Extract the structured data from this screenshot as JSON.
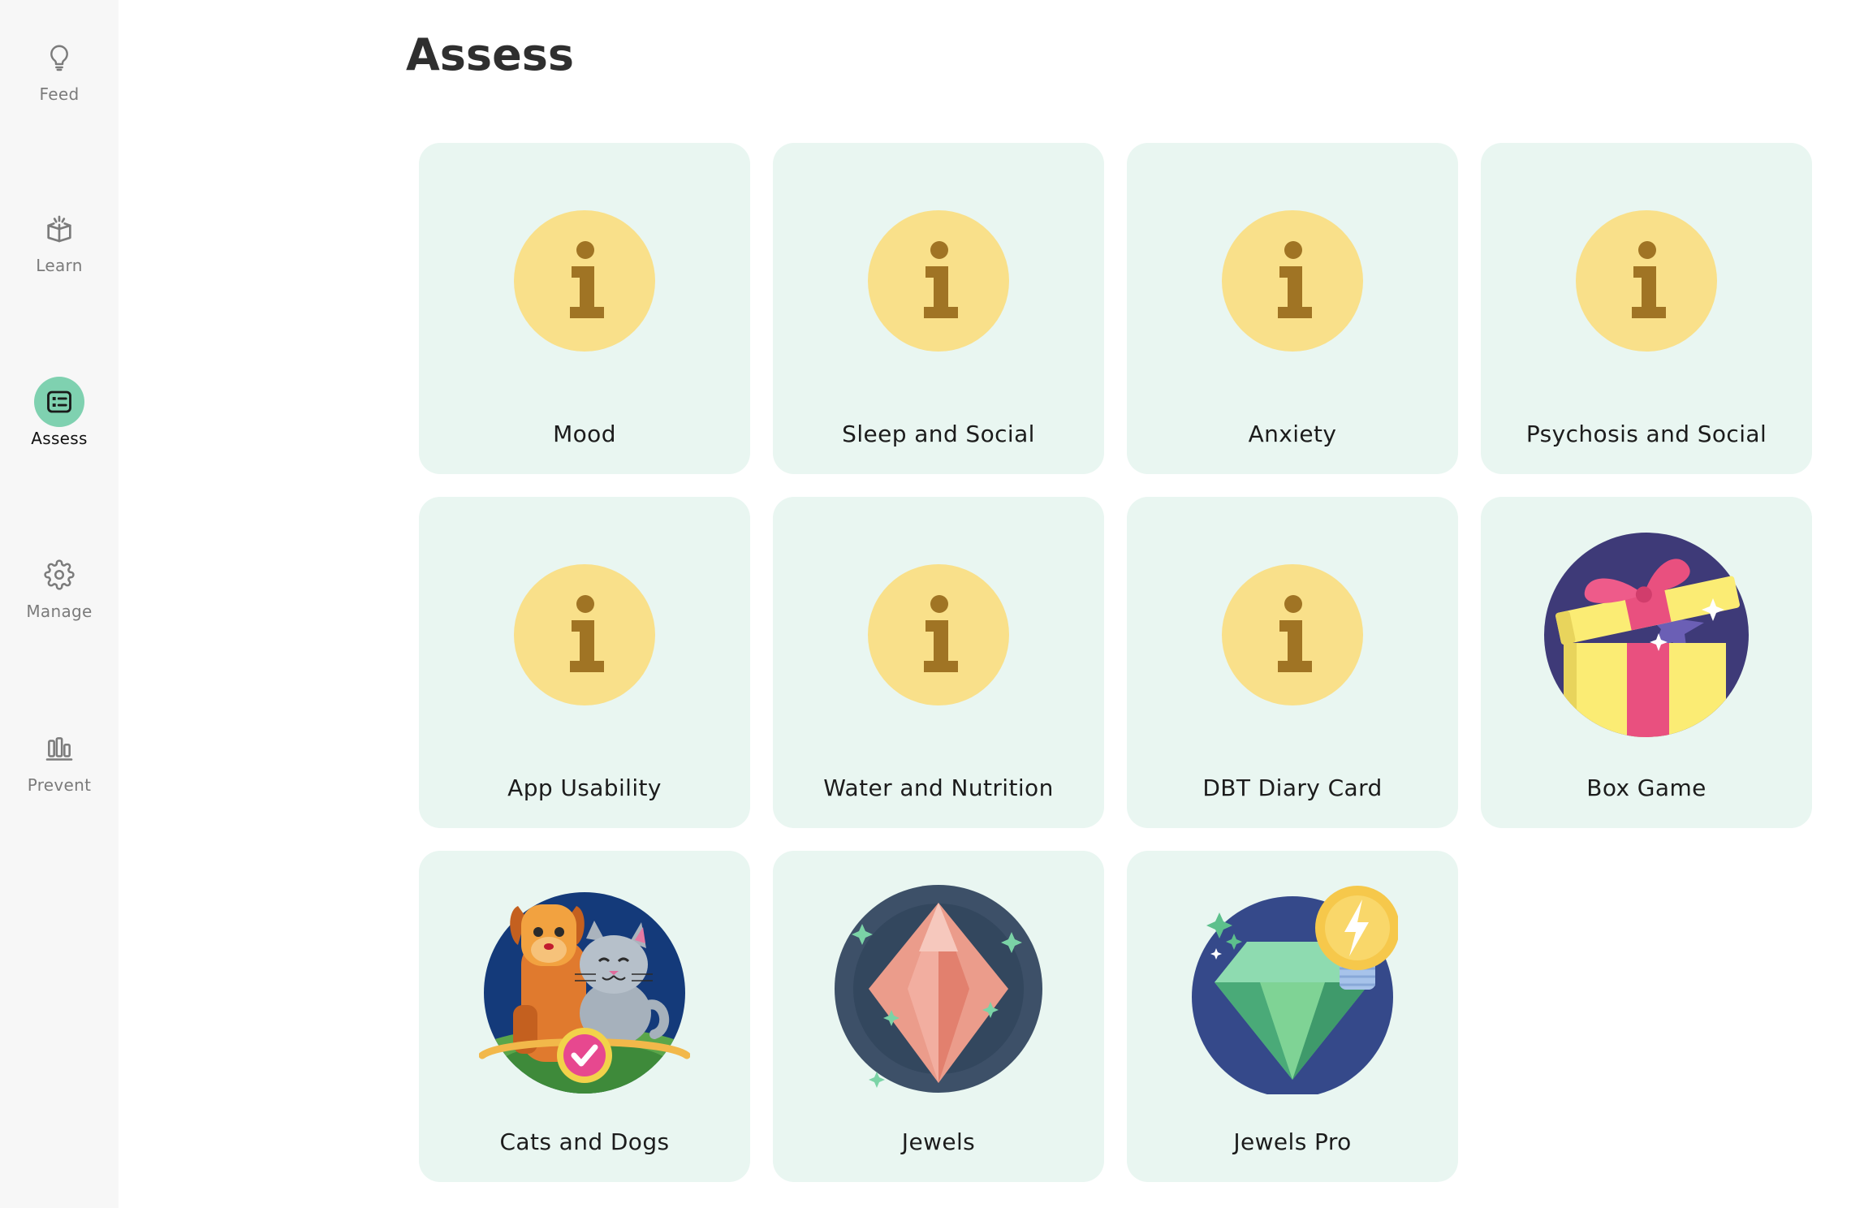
{
  "sidebar": {
    "items": [
      {
        "label": "Feed",
        "icon": "lightbulb-icon",
        "active": false
      },
      {
        "label": "Learn",
        "icon": "open-book-icon",
        "active": false
      },
      {
        "label": "Assess",
        "icon": "assessment-list-icon",
        "active": true
      },
      {
        "label": "Manage",
        "icon": "gear-icon",
        "active": false
      },
      {
        "label": "Prevent",
        "icon": "bar-chart-icon",
        "active": false
      }
    ]
  },
  "page": {
    "title": "Assess"
  },
  "activities": [
    {
      "label": "Mood",
      "icon": "info-icon"
    },
    {
      "label": "Sleep and Social",
      "icon": "info-icon"
    },
    {
      "label": "Anxiety",
      "icon": "info-icon"
    },
    {
      "label": "Psychosis and Social",
      "icon": "info-icon"
    },
    {
      "label": "App Usability",
      "icon": "info-icon"
    },
    {
      "label": "Water and Nutrition",
      "icon": "info-icon"
    },
    {
      "label": "DBT Diary Card",
      "icon": "info-icon"
    },
    {
      "label": "Box Game",
      "icon": "gift-box-icon"
    },
    {
      "label": "Cats and Dogs",
      "icon": "cats-and-dogs-icon"
    },
    {
      "label": "Jewels",
      "icon": "jewel-icon"
    },
    {
      "label": "Jewels Pro",
      "icon": "jewel-pro-icon"
    }
  ],
  "colors": {
    "accent": "#7fd1b0",
    "card_background": "#e9f6f1",
    "sidebar_background": "#f7f7f7",
    "info_circle": "#f9e08a",
    "info_glyph": "#a07424"
  }
}
